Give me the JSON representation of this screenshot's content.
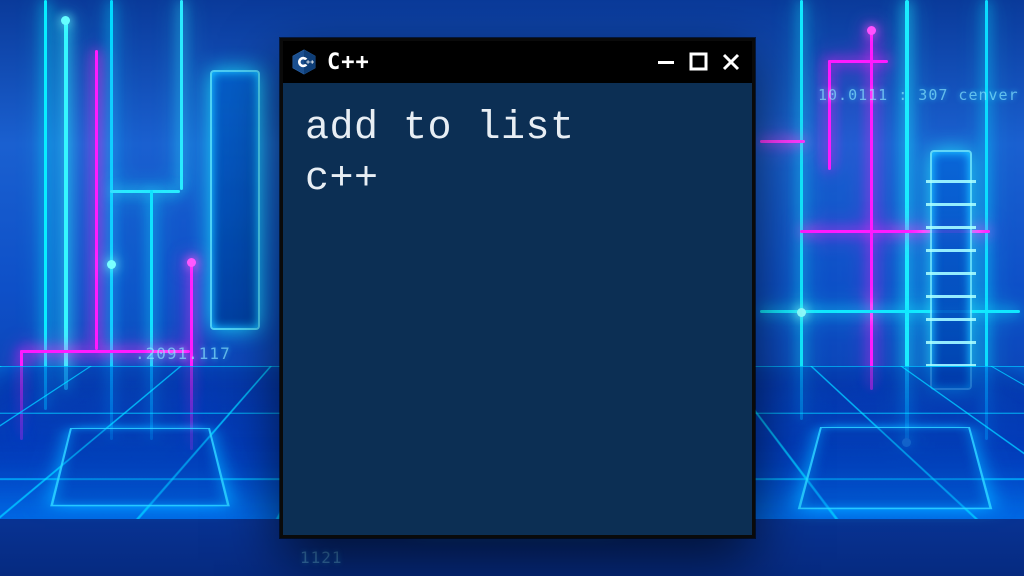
{
  "window": {
    "title": "C++",
    "content_line1": "add to list",
    "content_line2": "c++"
  },
  "background": {
    "label1": ".2091.117",
    "label2": "10.0111 : 307  cenver",
    "label3": "1121"
  },
  "colors": {
    "neon_cyan": "#30d8ff",
    "neon_magenta": "#ff2bd6",
    "window_bg": "#0c2f54"
  }
}
